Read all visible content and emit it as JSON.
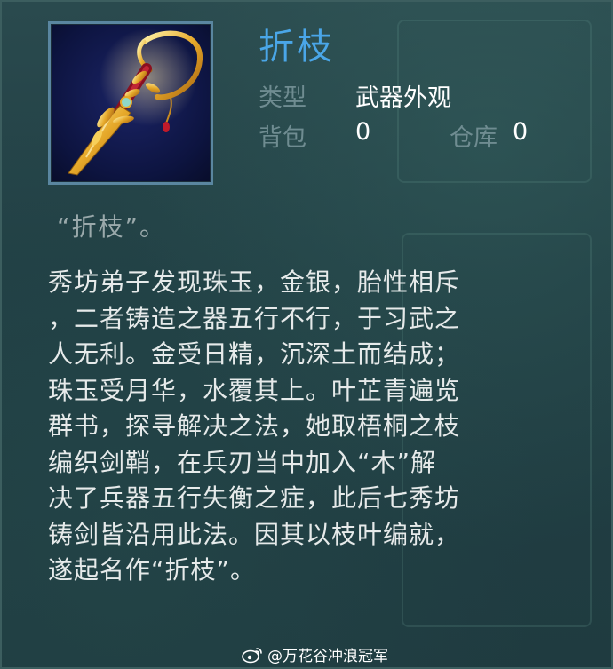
{
  "item": {
    "name": "折枝",
    "type_label": "类型",
    "type_value": "武器外观",
    "bag_label": "背包",
    "bag_value": "0",
    "warehouse_label": "仓库",
    "warehouse_value": "0",
    "subtitle": "“折枝”。",
    "icon": "golden-branch-sword-icon",
    "description_lines": [
      "秀坊弟子发现珠玉，金银，胎性相斥",
      "，二者铸造之器五行不行，于习武之",
      "人无利。金受日精，沉深土而结成；",
      "珠玉受月华，水覆其上。叶芷青遍览",
      "群书，探寻解决之法，她取梧桐之枝",
      "编织剑鞘，在兵刃当中加入“木”解",
      "决了兵器五行失衡之症，此后七秀坊",
      "铸剑皆沿用此法。因其以枝叶编就，",
      "遂起名作“折枝”。"
    ]
  },
  "watermark": {
    "text": "@万花谷冲浪冠军",
    "icon": "weibo-icon"
  },
  "colors": {
    "title": "#4aa6e8",
    "label": "#6f8c91",
    "value": "#ffffff",
    "description": "#e6eaea",
    "background": "#213f44"
  }
}
